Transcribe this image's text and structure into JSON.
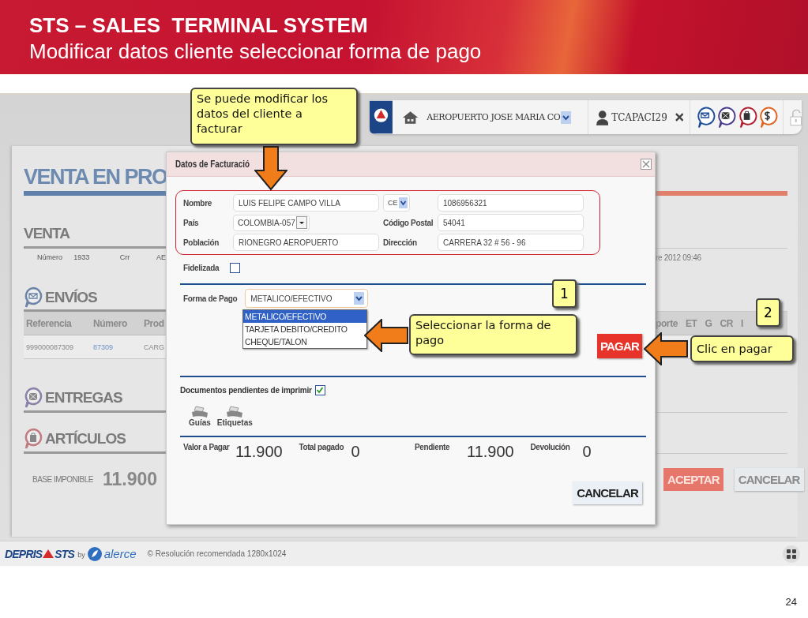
{
  "slide": {
    "title": "STS – SALES  TERMINAL SYSTEM",
    "subtitle": "Modificar datos cliente seleccionar forma de pago",
    "page_number": "24"
  },
  "toolbar": {
    "location": "AEROPUERTO JOSE MARIA CO",
    "user": "TCAPACI29"
  },
  "background": {
    "heading": "VENTA EN PRO",
    "venta": {
      "title": "VENTA",
      "fields": [
        {
          "label": "Número",
          "value": "1933"
        },
        {
          "label": "Crr",
          "value": "AE"
        }
      ],
      "date": "re 2012 09:46"
    },
    "envios": {
      "title": "ENVÍOS",
      "columns": [
        "Referencia",
        "Número",
        "Prod"
      ],
      "columns_right": [
        "porte",
        "ET",
        "G",
        "CR",
        "I"
      ],
      "row": [
        "999000087309",
        "87309",
        "CARG"
      ]
    },
    "entregas": {
      "title": "ENTREGAS"
    },
    "articulos": {
      "title": "ARTÍCULOS"
    },
    "base": {
      "label": "BASE IMPONIBLE",
      "value": "11.900"
    },
    "buttons": [
      {
        "label": "ACEPTAR",
        "kind": "primary"
      },
      {
        "label": "CANCELAR",
        "kind": "secondary"
      }
    ]
  },
  "dialog": {
    "title": "Datos de Facturació",
    "customer": {
      "name_label": "Nombre",
      "name": "LUIS FELIPE CAMPO VILLA",
      "id_type": "CE",
      "id_number": "1086956321",
      "country_label": "País",
      "country": "COLOMBIA-057",
      "postal_label": "Código Postal",
      "postal": "54041",
      "town_label": "Población",
      "town": "RIONEGRO AEROPUERTO",
      "address_label": "Dirección",
      "address": "CARRERA 32 # 56 - 96"
    },
    "loyalty": {
      "label": "Fidelizada",
      "checked": false
    },
    "payment": {
      "label": "Forma de Pago",
      "value": "METALICO/EFECTIVO",
      "options": [
        {
          "label": "METALICO/EFECTIVO",
          "selected": true
        },
        {
          "label": "TARJETA DEBITO/CREDITO",
          "selected": false
        },
        {
          "label": "CHEQUE/TALON",
          "selected": false
        }
      ]
    },
    "pay_button": "PAGAR",
    "print": {
      "label": "Documentos pendientes de imprimir",
      "checked": true,
      "documents": [
        "Guías",
        "Etiquetas"
      ]
    },
    "totals": [
      {
        "label": "Valor a Pagar",
        "value": "11.900"
      },
      {
        "label": "Total pagado",
        "value": "0"
      },
      {
        "label": "Pendiente",
        "value": "11.900"
      },
      {
        "label": "Devolución",
        "value": "0"
      }
    ],
    "cancel_button": "CANCELAR"
  },
  "footer": {
    "brand": "DEPRIS",
    "product": "STS",
    "by": "by",
    "partner": "alerce",
    "note": "© Resolución recomendada 1280x1024"
  },
  "callouts": [
    {
      "text": "Se puede modificar los datos del cliente a facturar",
      "kind": "arrow_down"
    },
    {
      "text": "Seleccionar la forma de pago",
      "kind": "arrow_left"
    },
    {
      "text": "Clic en pagar",
      "kind": "arrow_left"
    }
  ],
  "steps": [
    "1",
    "2"
  ]
}
